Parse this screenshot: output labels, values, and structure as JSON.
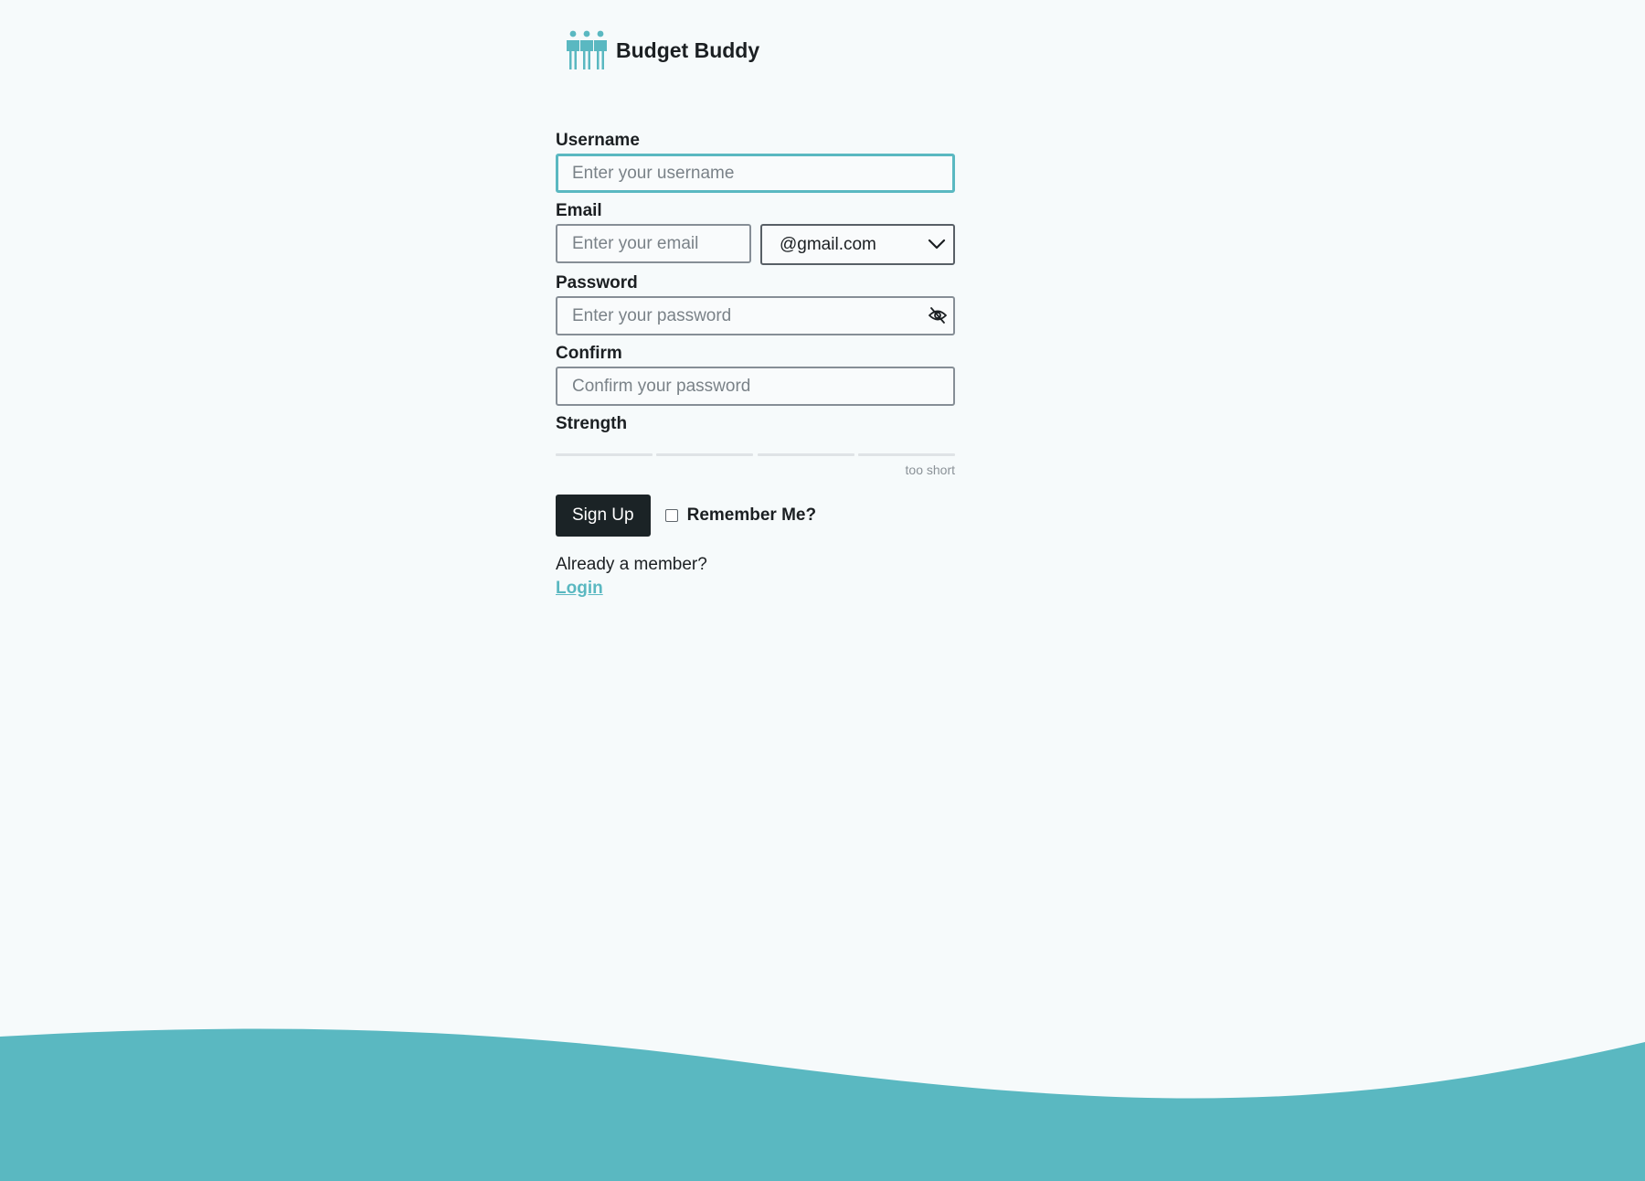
{
  "brand": {
    "name": "Budget Buddy",
    "logo_icon": "people-group-icon",
    "accent_color": "#5ab8c1"
  },
  "form": {
    "username": {
      "label": "Username",
      "placeholder": "Enter your username"
    },
    "email": {
      "label": "Email",
      "placeholder": "Enter your email",
      "domain_selected": "@gmail.com"
    },
    "password": {
      "label": "Password",
      "placeholder": "Enter your password",
      "toggle_icon": "eye-slash-icon"
    },
    "confirm": {
      "label": "Confirm",
      "placeholder": "Confirm your password"
    },
    "strength": {
      "label": "Strength",
      "status": "too short",
      "segments_total": 4,
      "segments_filled": 0
    },
    "submit_label": "Sign Up",
    "remember_label": "Remember Me?",
    "remember_checked": false
  },
  "footer": {
    "member_text": "Already a member?",
    "login_link": "Login"
  }
}
